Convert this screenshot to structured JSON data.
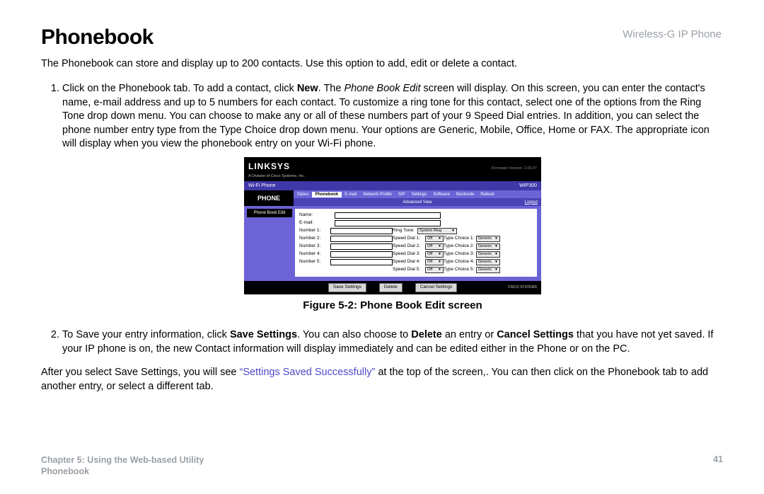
{
  "header_right": "Wireless-G IP Phone",
  "title": "Phonebook",
  "intro": "The Phonebook can store and display up to 200 contacts. Use this option to add, edit or delete a contact.",
  "step1": {
    "pre": "Click on the Phonebook tab. To add a contact, click ",
    "bold1": "New",
    "post1": ". The ",
    "italic": "Phone Book Edit",
    "post2": " screen will display. On this screen, you can enter the contact's name, e-mail address and up to 5 numbers for each contact. To customize a ring tone for this contact, select one of the options from the Ring Tone drop down menu. You can choose to make any or all of these numbers part of your 9 Speed Dial entries. In addition, you can select the phone number entry type from the Type Choice drop down menu.   Your options are Generic, Mobile, Office, Home or FAX. The appropriate icon will display when you view the phonebook entry on your Wi-Fi phone."
  },
  "figure": {
    "linksys": "LINKSYS",
    "division": "A Division of Cisco Systems, Inc.",
    "firmware": "Firmware Version: 1.00.07",
    "bar_left": "Wi-Fi Phone",
    "bar_right": "WIP300",
    "phone": "PHONE",
    "tabs": [
      "Status",
      "Phonebook",
      "E-mail",
      "Network Profile",
      "SIP",
      "Settings",
      "Software",
      "Bootcode",
      "Reboot"
    ],
    "advanced": "Advanced View",
    "logout": "Logout",
    "left_title": "Phone Book Edit",
    "labels": {
      "name": "Name:",
      "email": "E-mail:",
      "n1": "Number 1:",
      "n2": "Number 2:",
      "n3": "Number 3:",
      "n4": "Number 4:",
      "n5": "Number 5:",
      "ring": "Ring Tone:",
      "sd": [
        "Speed Dial 1:",
        "Speed Dial 2:",
        "Speed Dial 3:",
        "Speed Dial 4:",
        "Speed Dial 5:"
      ],
      "tc": [
        "Type Choice 1:",
        "Type Choice 2:",
        "Type Choice 3:",
        "Type Choice 4:",
        "Type Choice 5:"
      ]
    },
    "ring_val": "System Ring",
    "off": "Off",
    "generic": "Generic",
    "buttons": {
      "save": "Save Settings",
      "delete": "Delete",
      "cancel": "Cancel Settings"
    },
    "cisco": "CISCO SYSTEMS",
    "caption": "Figure 5-2: Phone Book Edit screen"
  },
  "step2": {
    "pre": "To Save your entry information, click ",
    "b1": "Save Settings",
    "m1": ". You can also choose to ",
    "b2": "Delete",
    "m2": " an entry or ",
    "b3": "Cancel Settings",
    "post": " that you have not yet saved. If your IP phone is on, the new Contact information will display immediately and can be edited either in the Phone or on the PC."
  },
  "after": {
    "pre": "After you select Save Settings, you will see ",
    "blue": "“Settings Saved Successfully”",
    "post": " at the top of the screen,. You can then click on the Phonebook tab to add another entry, or select a different tab."
  },
  "footer": {
    "line1": "Chapter 5: Using the Web-based Utility",
    "line2": "Phonebook",
    "page": "41"
  }
}
